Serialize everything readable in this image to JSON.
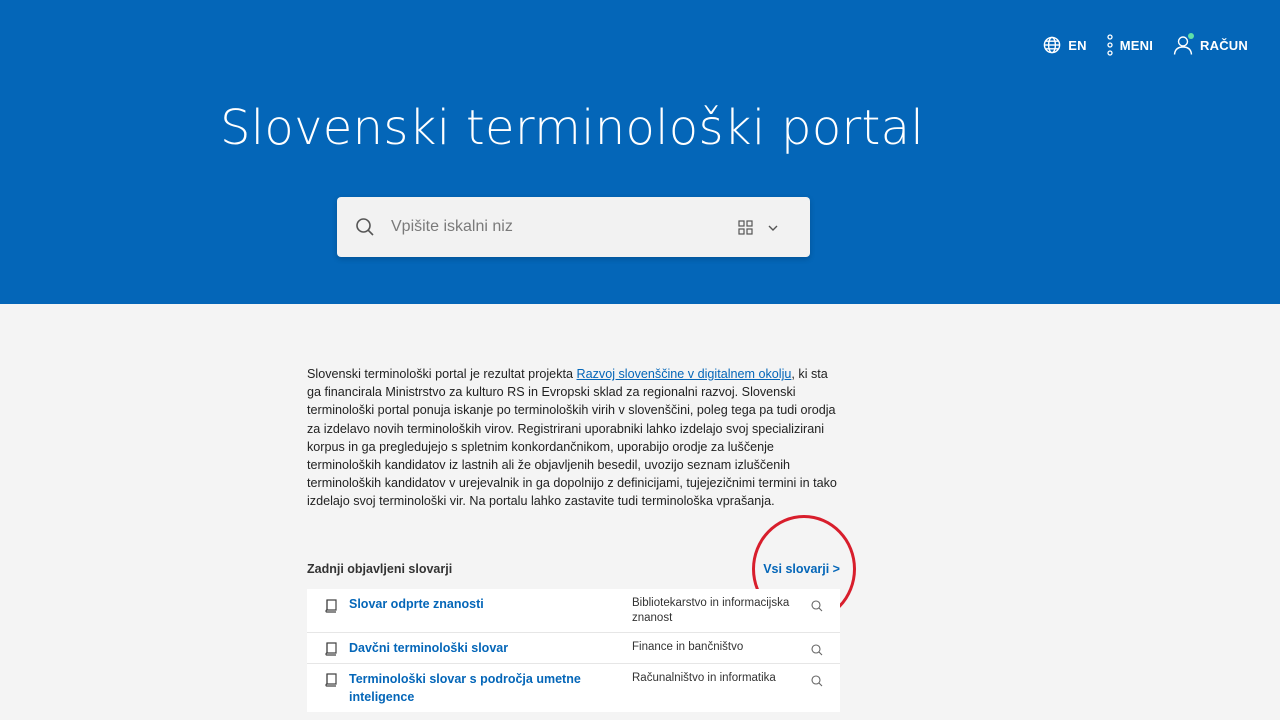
{
  "nav": {
    "lang_label": "EN",
    "menu_label": "MENI",
    "account_label": "RAČUN"
  },
  "hero": {
    "title": "Slovenski terminološki portal"
  },
  "search": {
    "placeholder": "Vpišite iskalni niz"
  },
  "intro": {
    "before_link": "Slovenski terminološki portal je rezultat projekta ",
    "link_text": "Razvoj slovenščine v digitalnem okolju",
    "after_link": ", ki sta ga financirala Ministrstvo za kulturo RS in Evropski sklad za regionalni razvoj. Slovenski terminološki portal ponuja iskanje po terminoloških virih v slovenščini, poleg tega pa tudi orodja za izdelavo novih terminoloških virov. Registrirani uporabniki lahko izdelajo svoj specializirani korpus in ga pregledujejo s spletnim konkordančnikom, uporabijo orodje za luščenje terminoloških kandidatov iz lastnih ali že objavljenih besedil, uvozijo seznam izluščenih terminoloških kandidatov v urejevalnik in ga dopolnijo z definicijami, tujejezičnimi termini in tako izdelajo svoj terminološki vir. Na portalu lahko zastavite tudi terminološka vprašanja."
  },
  "dictionaries": {
    "section_title": "Zadnji objavljeni slovarji",
    "all_link": "Vsi slovarji >",
    "items": [
      {
        "name": "Slovar odprte znanosti",
        "field": "Bibliotekarstvo in informacijska znanost"
      },
      {
        "name": "Davčni terminološki slovar",
        "field": "Finance in bančništvo"
      },
      {
        "name": "Terminološki slovar s področja umetne inteligence",
        "field": "Računalništvo in informatika"
      }
    ]
  },
  "colors": {
    "hero_blue": "#0466b8",
    "link_blue": "#0466b8",
    "annotation_red": "#d81e2c",
    "account_dot": "#5fe0a8"
  }
}
